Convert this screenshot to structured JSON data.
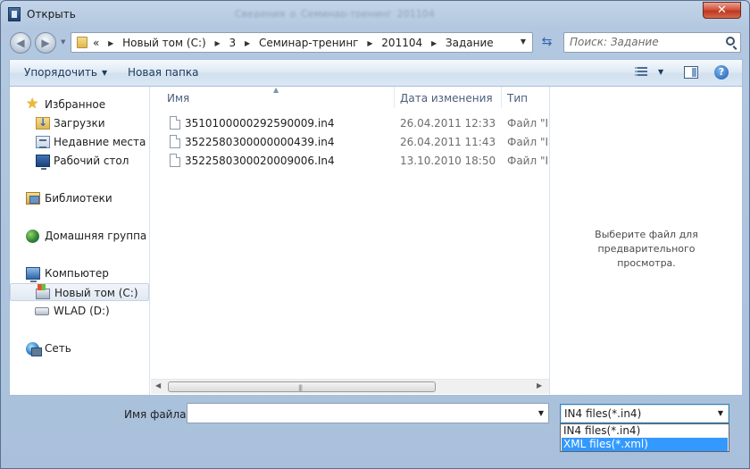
{
  "window": {
    "title": "Открыть",
    "close_symbol": "✕",
    "background_title": "Сведения_о_Семинар-тренинг_201104"
  },
  "address": {
    "overflow_symbol": "«",
    "crumbs": [
      "Новый том (C:)",
      "3",
      "Семинар-тренинг",
      "201104",
      "Задание"
    ],
    "search_placeholder": "Поиск: Задание"
  },
  "toolbar": {
    "organize_label": "Упорядочить",
    "new_folder_label": "Новая папка",
    "help_symbol": "?"
  },
  "nav": {
    "favorites": "Избранное",
    "downloads": "Загрузки",
    "recent": "Недавние места",
    "desktop": "Рабочий стол",
    "libraries": "Библиотеки",
    "homegroup": "Домашняя группа",
    "computer": "Компьютер",
    "drive_c": "Новый том (C:)",
    "drive_d": "WLAD (D:)",
    "network": "Сеть"
  },
  "columns": {
    "name": "Имя",
    "date": "Дата изменения",
    "type": "Тип"
  },
  "files": [
    {
      "name": "3510100000292590009.in4",
      "date": "26.04.2011 12:33",
      "type": "Файл \"IN"
    },
    {
      "name": "3522580300000000439.in4",
      "date": "26.04.2011 11:43",
      "type": "Файл \"IN"
    },
    {
      "name": "3522580300020009006.In4",
      "date": "13.10.2010 18:50",
      "type": "Файл \"IN"
    }
  ],
  "preview": {
    "line1": "Выберите файл для предварительного",
    "line2": "просмотра."
  },
  "footer": {
    "filename_label": "Имя файла:",
    "filename_value": "",
    "filetype_selected": "IN4 files(*.in4)",
    "filetype_options": [
      "IN4 files(*.in4)",
      "XML files(*.xml)"
    ]
  },
  "colors": {
    "selection": "#3399ff",
    "frame": "#b3c8e0"
  }
}
